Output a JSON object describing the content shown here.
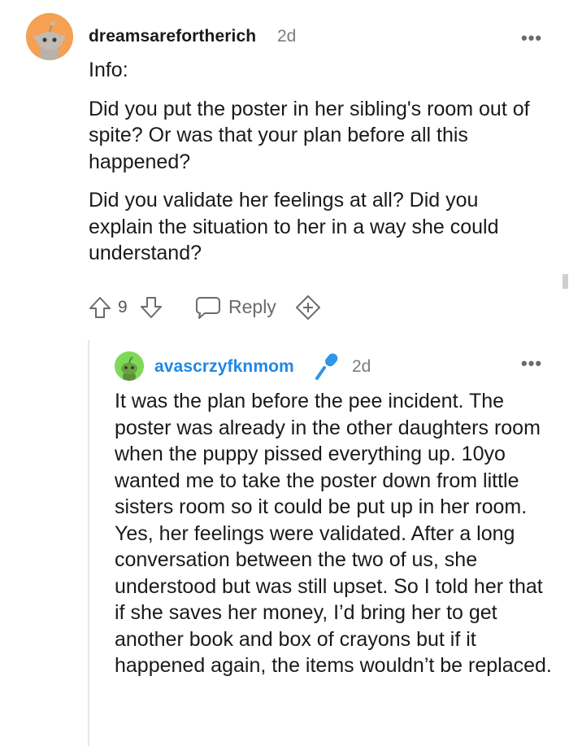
{
  "comment": {
    "username": "dreamsarefortherich",
    "age": "2d",
    "paragraphs": [
      "Info:",
      "Did you put the poster in her sibling's room out of spite? Or was that your plan before all this happened?",
      "Did you validate her feelings at all? Did you explain the situation to her in a way she could understand?"
    ],
    "score": "9",
    "reply_label": "Reply",
    "more_label": "•••",
    "avatar_color": "#f5a052"
  },
  "reply": {
    "username": "avascrzyfknmom",
    "age": "2d",
    "username_color": "#1e88e5",
    "body": "It was the plan before the pee incident. The poster was already in the other daughters room when the puppy pissed everything up. 10yo wanted me to take the poster down from little sisters room so it could be put up in her room. Yes, her feelings were validated. After a long conversation between the two of us, she understood but was still upset. So I told her that if she saves her money, I’d bring her to get another book and box of crayons but if it happened again, the items wouldn’t be replaced.",
    "more_label": "•••",
    "avatar_color": "#7ed957"
  }
}
